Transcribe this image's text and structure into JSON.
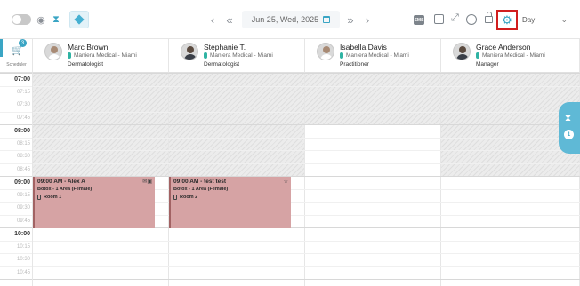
{
  "toolbar": {
    "date_label": "Jun 25, Wed, 2025",
    "sms_label": "SMS",
    "view_selected": "Day",
    "accent_color": "#3aa5c4"
  },
  "rail": {
    "cart_count": "3",
    "label": "Scheduler"
  },
  "staff": [
    {
      "name": "Marc Brown",
      "clinic": "Maniera Medical - Miami",
      "role": "Dermatologist"
    },
    {
      "name": "Stephanie T.",
      "clinic": "Maniera Medical - Miami",
      "role": "Dermatologist"
    },
    {
      "name": "Isabella Davis",
      "clinic": "Maniera Medical - Miami",
      "role": "Practitioner"
    },
    {
      "name": "Grace Anderson",
      "clinic": "Maniera Medical - Miami",
      "role": "Manager"
    }
  ],
  "times": [
    "07:00",
    "07:15",
    "07:30",
    "07:45",
    "08:00",
    "08:15",
    "08:30",
    "08:45",
    "09:00",
    "09:15",
    "09:30",
    "09:45",
    "10:00",
    "10:15",
    "10:30",
    "10:45"
  ],
  "appointments": [
    {
      "title": "09:00 AM - Alex A",
      "service": "Botox - 1 Area (Female)",
      "room": "Room 1",
      "color": "#d6a3a4"
    },
    {
      "title": "09:00 AM - test test",
      "service": "Botox - 1 Area (Female)",
      "room": "Room 2",
      "color": "#d6a3a4"
    }
  ],
  "waitlist": {
    "count": "1"
  }
}
